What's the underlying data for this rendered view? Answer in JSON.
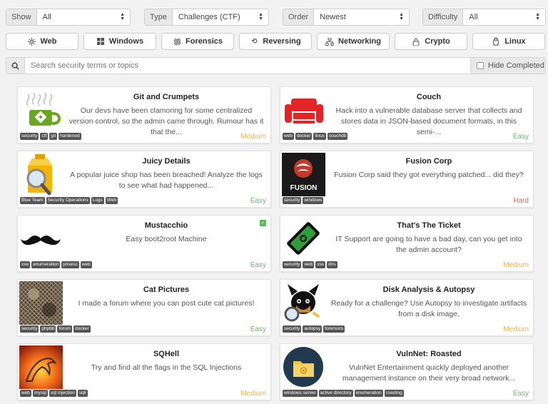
{
  "filters": {
    "show": {
      "label": "Show",
      "value": "All"
    },
    "type": {
      "label": "Type",
      "value": "Challenges (CTF)"
    },
    "order": {
      "label": "Order",
      "value": "Newest"
    },
    "difficulty": {
      "label": "Difficulty",
      "value": "All"
    }
  },
  "categories": [
    {
      "label": "Web",
      "icon": "web-icon"
    },
    {
      "label": "Windows",
      "icon": "windows-icon"
    },
    {
      "label": "Forensics",
      "icon": "fingerprint-icon"
    },
    {
      "label": "Reversing",
      "icon": "undo-icon"
    },
    {
      "label": "Networking",
      "icon": "network-icon"
    },
    {
      "label": "Crypto",
      "icon": "lock-icon"
    },
    {
      "label": "Linux",
      "icon": "linux-icon"
    }
  ],
  "search": {
    "placeholder": "Search security terms or topics",
    "value": "",
    "hide_completed_label": "Hide Completed"
  },
  "colors": {
    "easy": "#6fb26f",
    "medium": "#f0ad4e",
    "hard": "#e06a4b",
    "tag_bg": "#555555"
  },
  "rooms": [
    {
      "title": "Git and Crumpets",
      "desc": "Our devs have been clamoring for some centralized version control, so the admin came through. Rumour has it that the...",
      "tags": [
        "security",
        "ctf",
        "git",
        "hardened"
      ],
      "difficulty": "Medium",
      "thumb": "git-icon"
    },
    {
      "title": "Couch",
      "desc": "Hack into a vulnerable database server that collects and stores data in JSON-based document formats, in this semi-...",
      "tags": [
        "web",
        "docker",
        "linux",
        "couchdb"
      ],
      "difficulty": "Easy",
      "thumb": "couch-icon"
    },
    {
      "title": "Juicy Details",
      "desc": "A popular juice shop has been breached! Analyze the logs to see what had happened...",
      "tags": [
        "Blue Team",
        "Security Operations",
        "Logs",
        "Web"
      ],
      "difficulty": "Easy",
      "thumb": "juice-magnifier-icon"
    },
    {
      "title": "Fusion Corp",
      "desc": "Fusion Corp said they got everything patched... did they?",
      "tags": [
        "security",
        "windows"
      ],
      "difficulty": "Hard",
      "thumb": "fusion-logo",
      "thumb_text": "FUSION"
    },
    {
      "title": "Mustacchio",
      "desc": "Easy boot2root Machine",
      "tags": [
        "xxe",
        "enumeration",
        "privesc",
        "web"
      ],
      "difficulty": "Easy",
      "thumb": "mustache-icon",
      "completed": true
    },
    {
      "title": "That's The Ticket",
      "desc": "IT Support are going to have a bad day, can you get into the admin account?",
      "tags": [
        "security",
        "web",
        "xss",
        "dns"
      ],
      "difficulty": "Medium",
      "thumb": "ticket-icon"
    },
    {
      "title": "Cat Pictures",
      "desc": "I made a forum where you can post cute cat pictures!",
      "tags": [
        "security",
        "phpbb",
        "forum",
        "docker"
      ],
      "difficulty": "Easy",
      "thumb": "cat-photo"
    },
    {
      "title": "Disk Analysis & Autopsy",
      "desc": "Ready for a challenge? Use Autopsy to investigate artifacts from a disk image.",
      "tags": [
        "security",
        "autopsy",
        "forensics"
      ],
      "difficulty": "Medium",
      "thumb": "autopsy-dog-icon"
    },
    {
      "title": "SQHell",
      "desc": "Try and find all the flags in the SQL Injections",
      "tags": [
        "web",
        "mysql",
        "sql injection",
        "sqli"
      ],
      "difficulty": "Medium",
      "thumb": "fire-dolphin-icon"
    },
    {
      "title": "VulnNet: Roasted",
      "desc": "VulnNet Entertainment quickly deployed another management instance on their very broad network...",
      "tags": [
        "windows server",
        "active directory",
        "enumeration",
        "roasting"
      ],
      "difficulty": "Easy",
      "thumb": "folder-icon"
    }
  ]
}
